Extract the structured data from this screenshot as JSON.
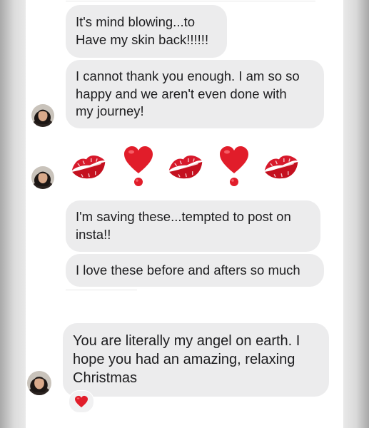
{
  "messages": [
    {
      "text": "It's mind blowing...to\nHave my skin back!!!!!!"
    },
    {
      "text": "I cannot thank you enough. I am so so\nhappy and we aren't even done with\nmy journey!"
    },
    {
      "emoji_row": [
        "kiss-mark-icon",
        "heart-exclamation-icon",
        "kiss-mark-icon",
        "heart-exclamation-icon",
        "kiss-mark-icon"
      ]
    },
    {
      "text": "I'm saving these...tempted to post on\ninsta!!"
    },
    {
      "text": "I love these before and afters so much"
    },
    {
      "text": "You are literally my angel on earth. I\nhope you had an amazing, relaxing\nChristmas",
      "reaction": "red-heart-icon"
    }
  ],
  "colors": {
    "bubble": "#ececed",
    "text": "#1d1d1f",
    "heart": "#e11d2a",
    "kiss": "#d7192b"
  }
}
